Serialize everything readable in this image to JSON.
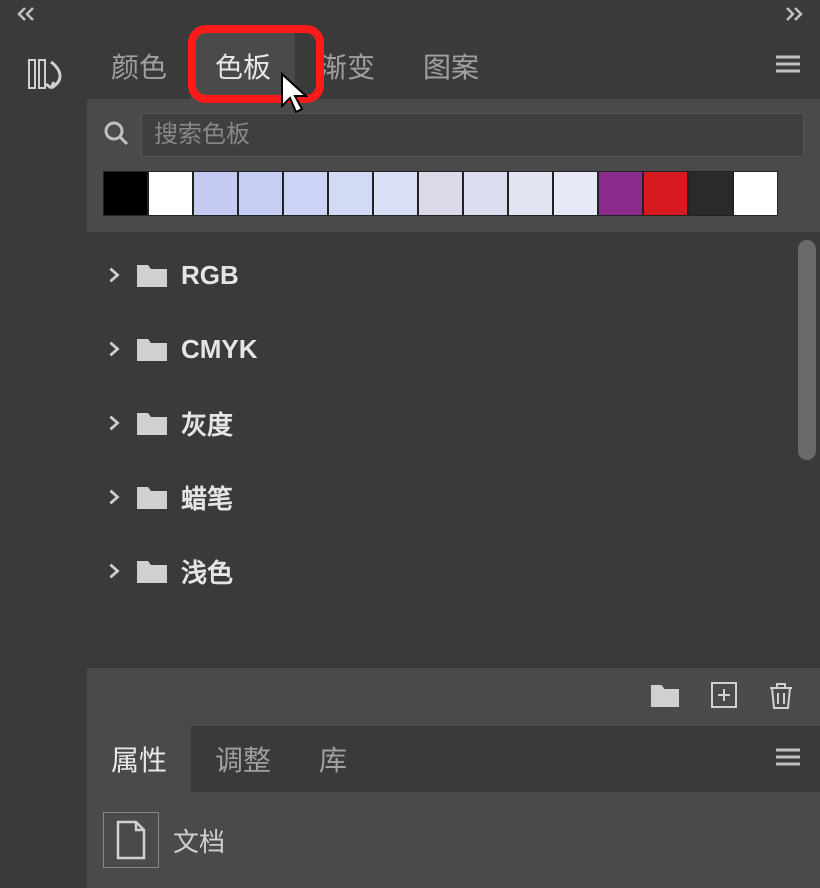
{
  "topbar": {},
  "sidebar": {
    "label": ""
  },
  "panel1": {
    "tabs": [
      {
        "label": "颜色"
      },
      {
        "label": "色板"
      },
      {
        "label": "渐变"
      },
      {
        "label": "图案"
      }
    ],
    "search": {
      "placeholder": "搜索色板"
    },
    "swatches": [
      "#000000",
      "#ffffff",
      "#c5caf2",
      "#c7cef4",
      "#ccd3f5",
      "#d3daf6",
      "#dadff7",
      "#d9d9e9",
      "#dcdef0",
      "#e2e3f3",
      "#e8e9f6",
      "#8b2b8b",
      "#d8191f",
      "#2a2a2a",
      "#ffffff"
    ],
    "folders": [
      {
        "name": "RGB"
      },
      {
        "name": "CMYK"
      },
      {
        "name": "灰度"
      },
      {
        "name": "蜡笔"
      },
      {
        "name": "浅色"
      }
    ]
  },
  "panel2": {
    "tabs": [
      {
        "label": "属性"
      },
      {
        "label": "调整"
      },
      {
        "label": "库"
      }
    ],
    "doc_label": "文档"
  }
}
